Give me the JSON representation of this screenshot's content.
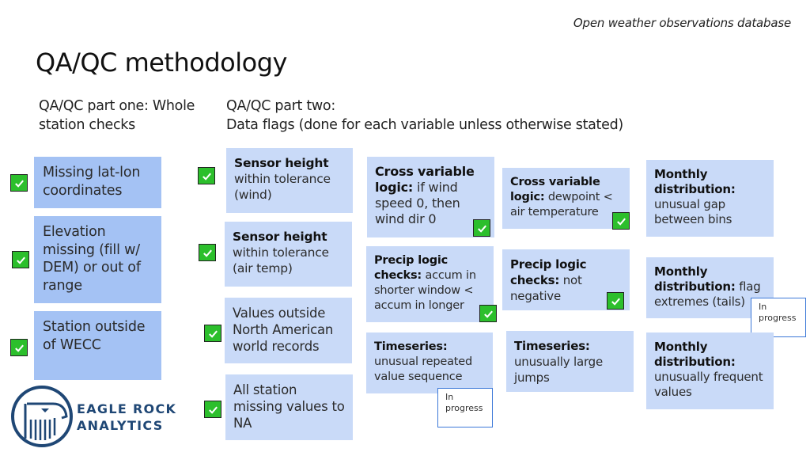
{
  "header": {
    "subtitle": "Open weather observations database",
    "title": "QA/QC methodology"
  },
  "part_one": {
    "heading": "QA/QC part one: Whole station checks",
    "items": [
      {
        "text": "Missing lat-lon coordinates",
        "status": "done"
      },
      {
        "text": "Elevation missing (fill w/ DEM) or out of range",
        "status": "done"
      },
      {
        "text": "Station outside of WECC",
        "status": "done"
      }
    ]
  },
  "part_two": {
    "heading_line1": "QA/QC part two:",
    "heading_line2": "Data flags (done for each variable unless otherwise stated)",
    "items": [
      {
        "bold": "Sensor height",
        "text": " within tolerance (wind)",
        "status": "done"
      },
      {
        "bold": "Sensor height",
        "text": " within tolerance (air temp)",
        "status": "done"
      },
      {
        "bold": "",
        "text": "Values outside North American world records",
        "status": "done"
      },
      {
        "bold": "",
        "text": "All station missing values to NA",
        "status": "done"
      },
      {
        "bold": "Cross variable logic:",
        "text": " if wind speed 0, then wind dir 0",
        "status": "done"
      },
      {
        "bold": "Precip logic checks:",
        "text": " accum in shorter window < accum in longer",
        "status": "done"
      },
      {
        "bold": "Timeseries:",
        "text": " unusual repeated value sequence",
        "status": "in progress"
      },
      {
        "bold": "Cross variable logic:",
        "text": " dewpoint < air temperature",
        "status": "done"
      },
      {
        "bold": "Precip logic checks:",
        "text": " not negative",
        "status": "done"
      },
      {
        "bold": "Timeseries:",
        "text": " unusually large jumps",
        "status": "pending"
      },
      {
        "bold": "Monthly distribution:",
        "text": " unusual gap between bins",
        "status": "pending"
      },
      {
        "bold": "Monthly distribution:",
        "text": " flag extremes (tails)",
        "status": "in progress"
      },
      {
        "bold": "Monthly distribution:",
        "text": " unusually frequent values",
        "status": "pending"
      }
    ]
  },
  "in_progress_label": "In progress",
  "logo": {
    "line1": "EAGLE ROCK",
    "line2": "ANALYTICS"
  },
  "colors": {
    "check_green": "#2cbf2c",
    "box_dark": "#a4c2f4",
    "box_light": "#c9daf8",
    "progress_border": "#3c78d8",
    "logo_navy": "#1f4775"
  }
}
